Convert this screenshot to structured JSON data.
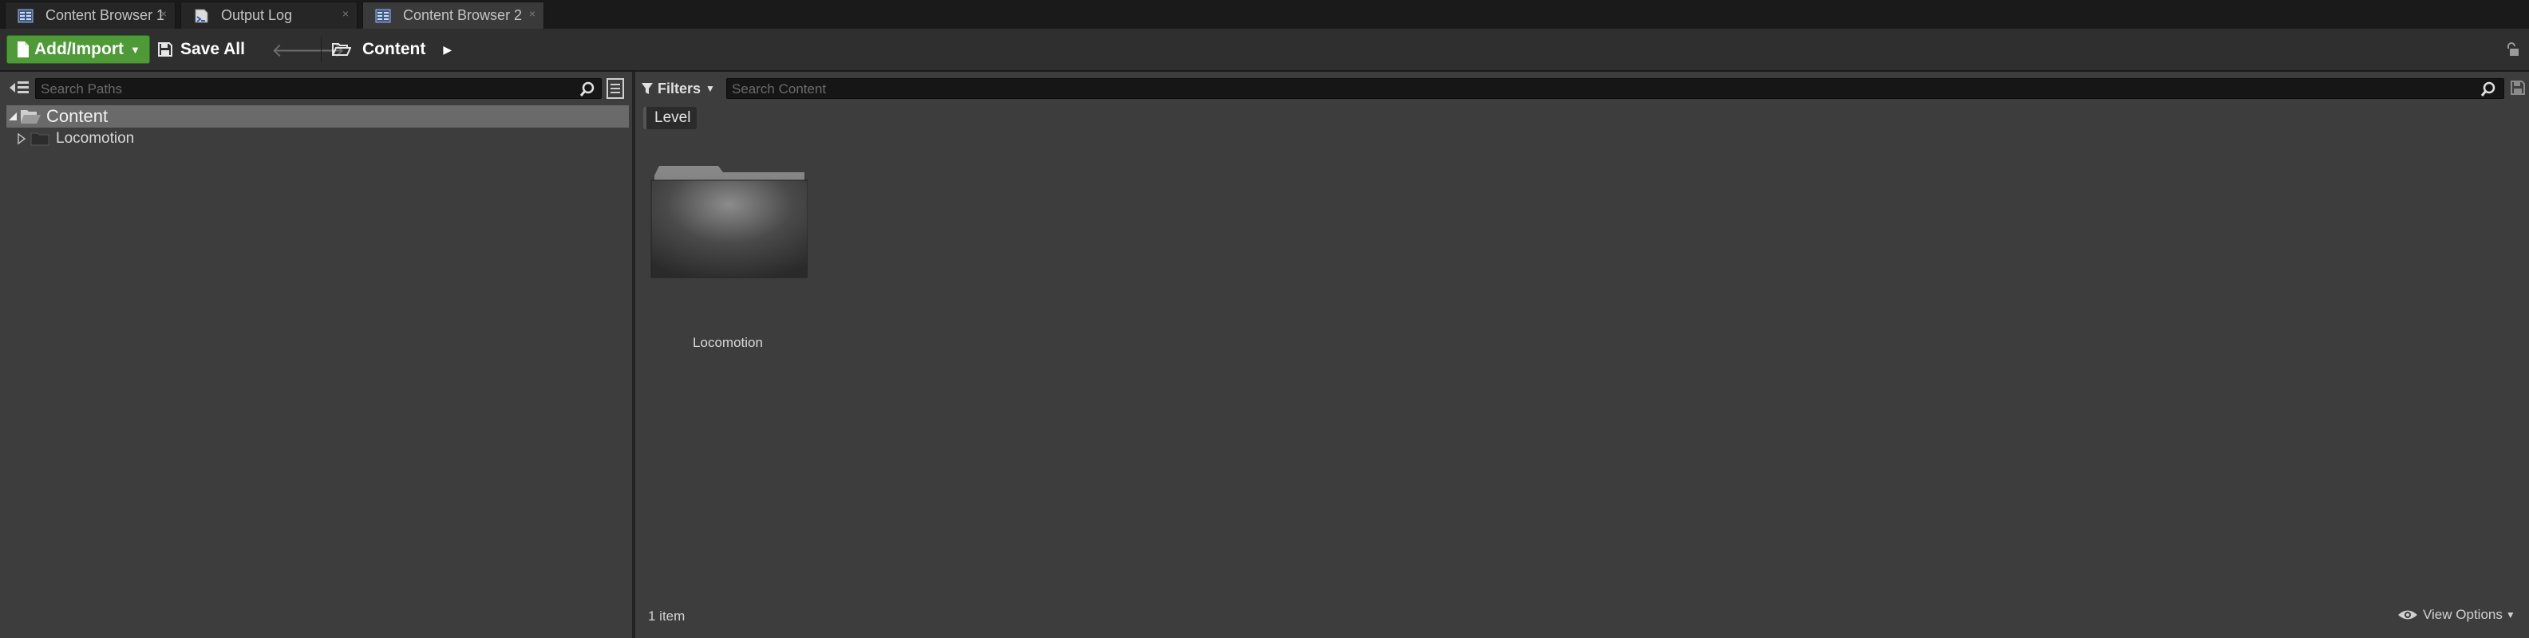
{
  "tabs": [
    {
      "label": "Content Browser 1",
      "icon": "content-browser-icon",
      "active": false
    },
    {
      "label": "Output Log",
      "icon": "output-log-icon",
      "active": false
    },
    {
      "label": "Content Browser 2",
      "icon": "content-browser-icon",
      "active": true
    }
  ],
  "toolbar": {
    "add_label": "Add/Import",
    "save_label": "Save All",
    "breadcrumb": "Content"
  },
  "paths_panel": {
    "search_placeholder": "Search Paths",
    "tree": [
      {
        "label": "Content",
        "expanded": true,
        "selected": true
      },
      {
        "label": "Locomotion",
        "expanded": false,
        "selected": false
      }
    ]
  },
  "content_panel": {
    "filters_label": "Filters",
    "search_placeholder": "Search Content",
    "filter_chip": "Level",
    "items": [
      {
        "label": "Locomotion",
        "type": "folder"
      }
    ],
    "item_count": "1 item",
    "view_options_label": "View Options"
  },
  "colors": {
    "accent_green": "#4d9a37",
    "panel_bg": "#3d3d3d",
    "tab_bar_bg": "#1a1a1a"
  }
}
